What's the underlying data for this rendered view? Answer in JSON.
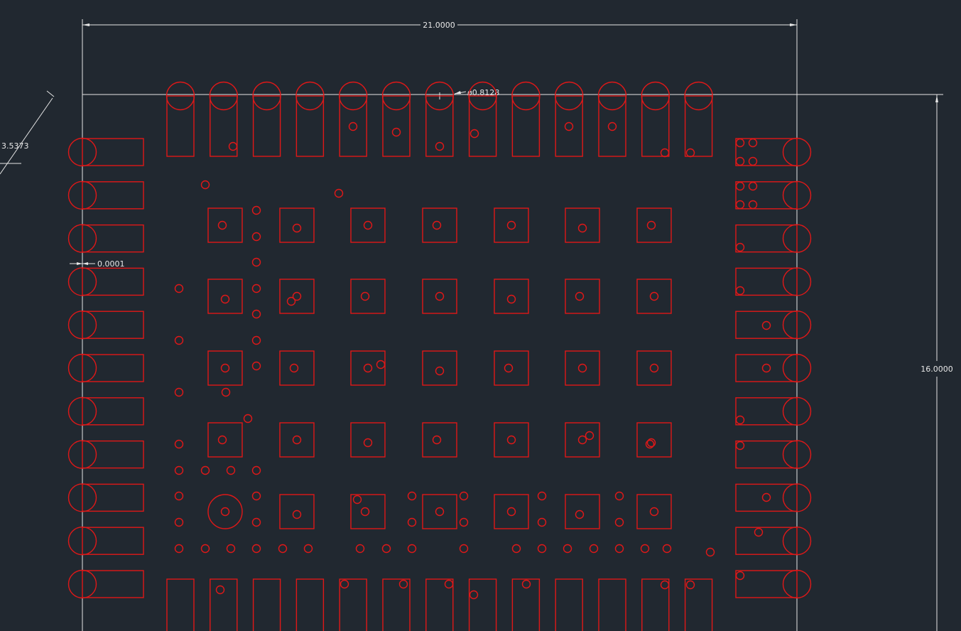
{
  "drawing": {
    "background": "#212830",
    "pad_color": "#e01818",
    "dimension_color": "#e6e6e6"
  },
  "dimensions": {
    "width": "21.0000",
    "height": "16.0000",
    "diameter": "ø0.8128",
    "aligned": "3.5373",
    "gap": "0.0001"
  },
  "pad_layout": {
    "top_row_pins": 13,
    "bottom_row_pins": 13,
    "left_column_pins": 11,
    "right_column_pins": 11,
    "thermal_pad_grid": {
      "columns": 7,
      "rows": 5
    }
  }
}
